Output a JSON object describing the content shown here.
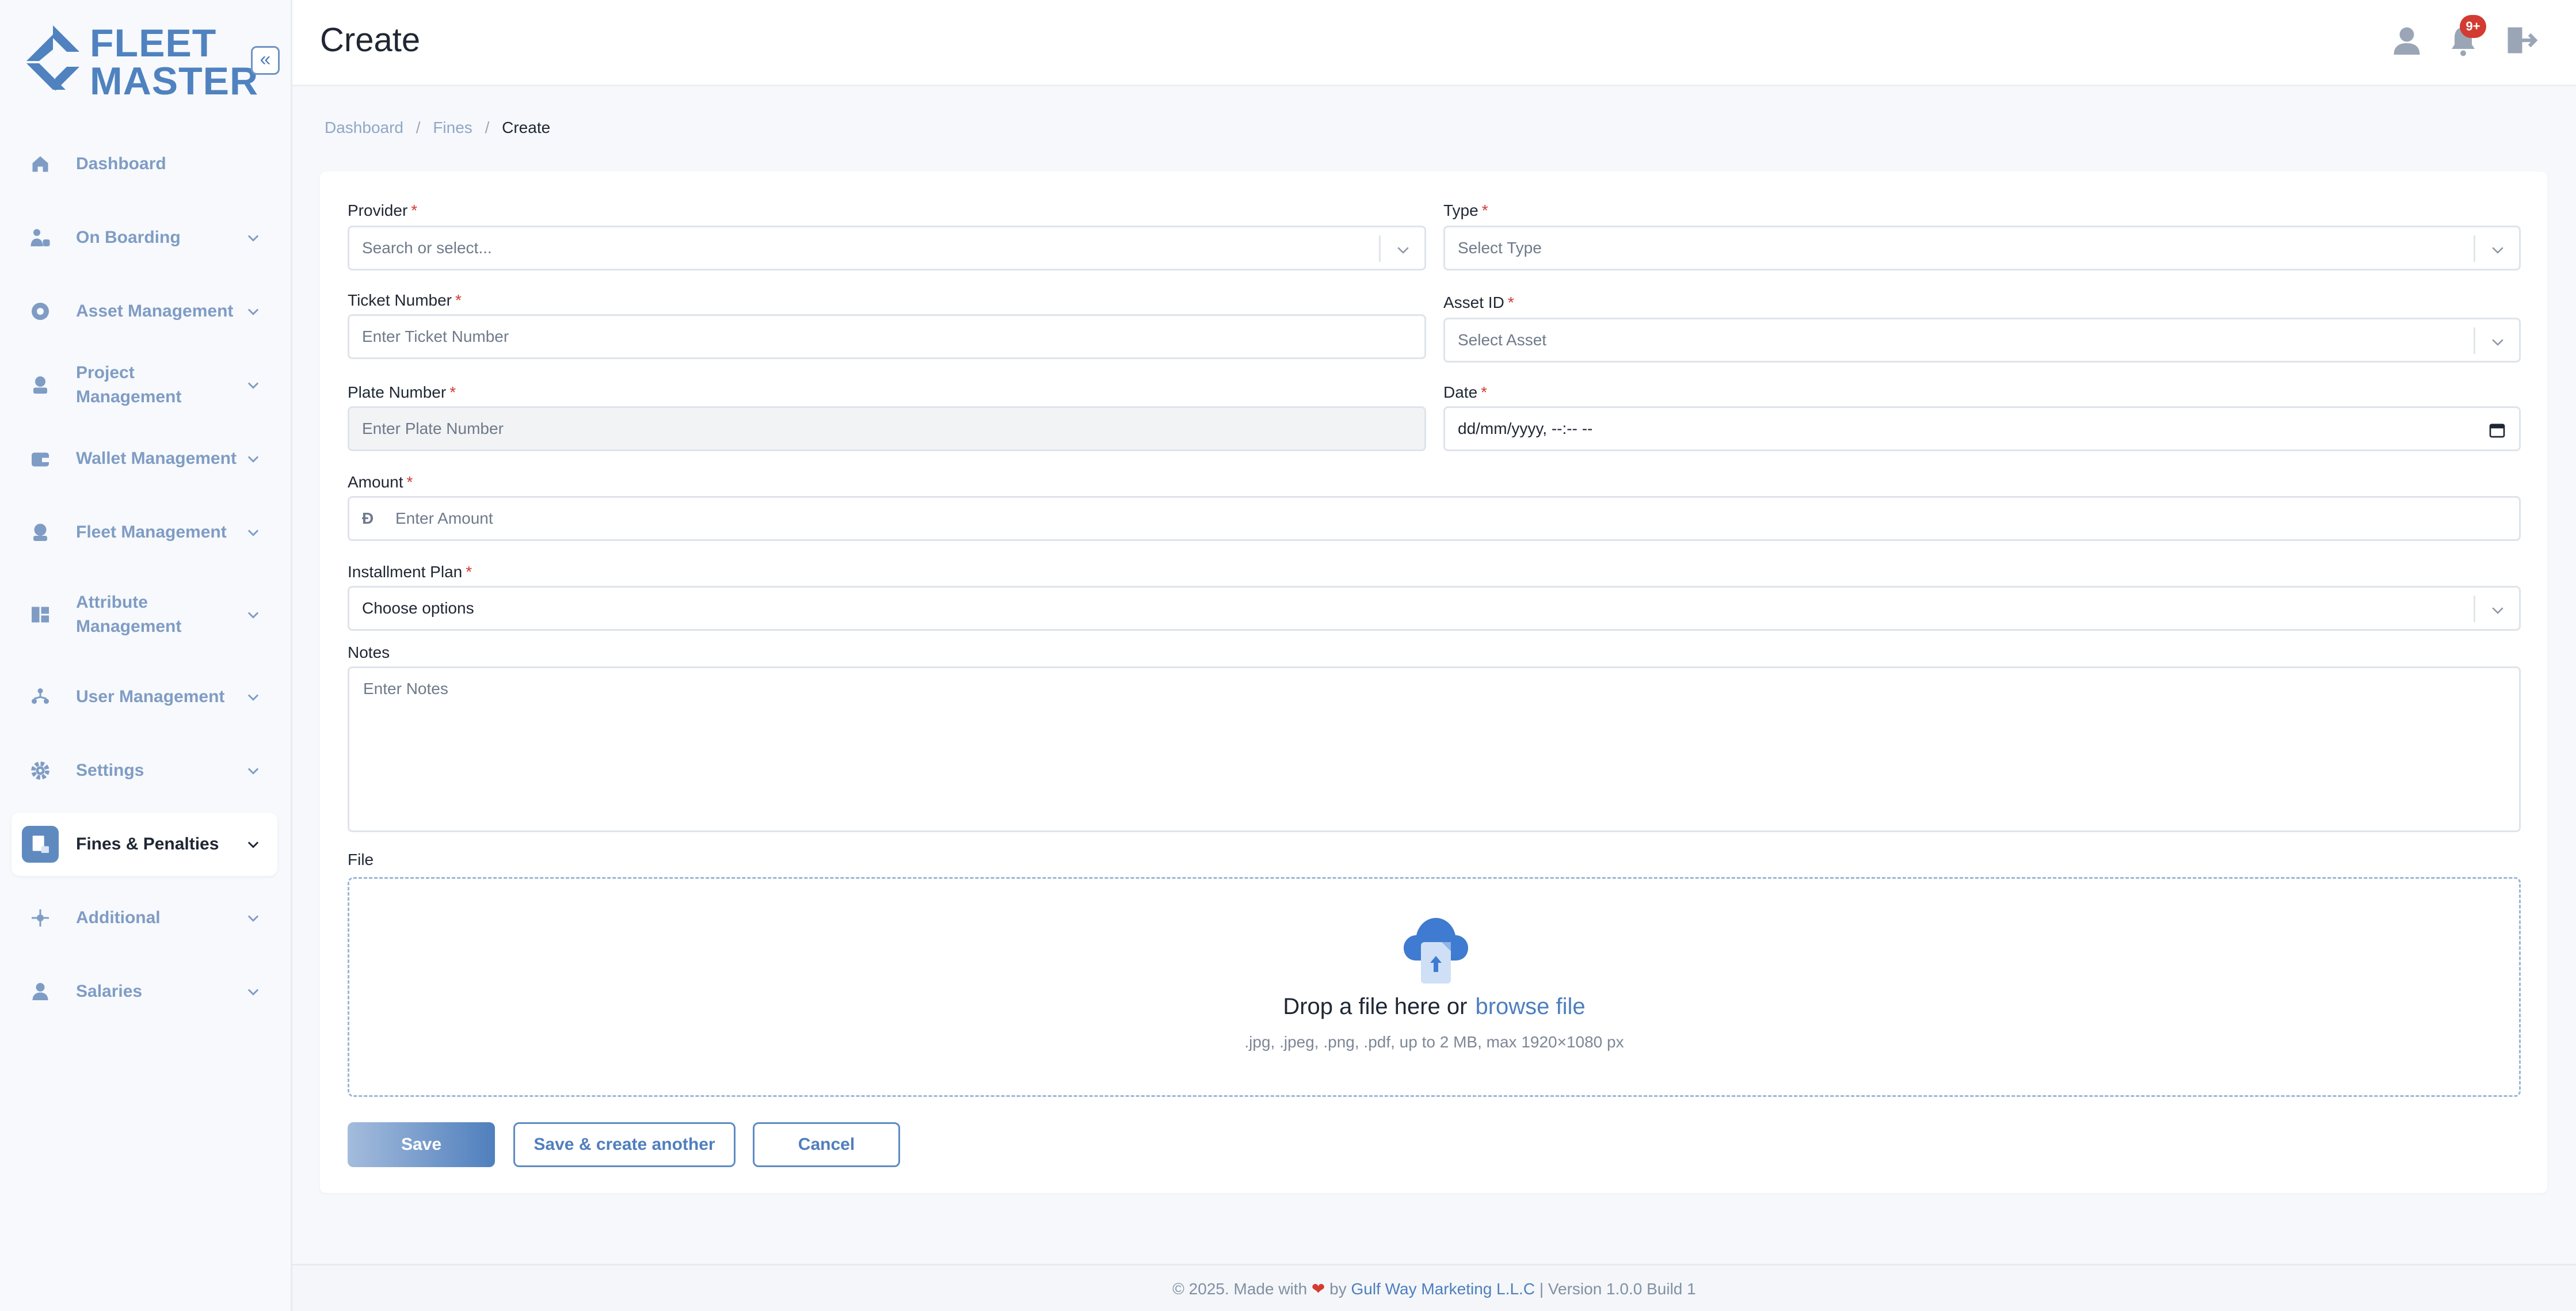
{
  "app": {
    "logo_line1": "FLEET",
    "logo_line2": "MASTER"
  },
  "sidebar": {
    "collapse_glyph": "«",
    "items": [
      {
        "label": "Dashboard",
        "icon": "home-icon"
      },
      {
        "label": "On Boarding",
        "icon": "onboarding-icon"
      },
      {
        "label": "Asset Management",
        "icon": "asset-icon"
      },
      {
        "label": "Project Management",
        "icon": "project-icon"
      },
      {
        "label": "Wallet Management",
        "icon": "wallet-icon"
      },
      {
        "label": "Fleet Management",
        "icon": "fleet-icon"
      },
      {
        "label": "Attribute Management",
        "icon": "attribute-icon"
      },
      {
        "label": "User Management",
        "icon": "users-icon"
      },
      {
        "label": "Settings",
        "icon": "gear-icon"
      },
      {
        "label": "Fines & Penalties",
        "icon": "fines-icon",
        "active": true
      },
      {
        "label": "Additional",
        "icon": "additional-icon"
      },
      {
        "label": "Salaries",
        "icon": "salaries-icon"
      }
    ]
  },
  "header": {
    "title": "Create",
    "notification_badge": "9+"
  },
  "breadcrumb": {
    "items": [
      "Dashboard",
      "Fines"
    ],
    "current": "Create",
    "separator": "/"
  },
  "form": {
    "required_mark": "*",
    "provider": {
      "label": "Provider",
      "placeholder": "Search or select..."
    },
    "type": {
      "label": "Type",
      "placeholder": "Select Type"
    },
    "ticket_number": {
      "label": "Ticket Number",
      "placeholder": "Enter Ticket Number"
    },
    "asset_id": {
      "label": "Asset ID",
      "placeholder": "Select Asset"
    },
    "plate_number": {
      "label": "Plate Number",
      "placeholder": "Enter Plate Number"
    },
    "date": {
      "label": "Date",
      "placeholder": "dd/mm/yyyy, --:-- --"
    },
    "amount": {
      "label": "Amount",
      "placeholder": "Enter Amount",
      "currency_glyph": "Đ"
    },
    "installment_plan": {
      "label": "Installment Plan",
      "placeholder": "Choose options"
    },
    "notes": {
      "label": "Notes",
      "placeholder": "Enter Notes"
    },
    "file": {
      "label": "File",
      "drop_text": "Drop a file here or",
      "browse_text": "browse file",
      "hint": ".jpg, .jpeg, .png, .pdf, up to 2 MB, max 1920×1080 px"
    },
    "buttons": {
      "save": "Save",
      "save_another": "Save & create another",
      "cancel": "Cancel"
    }
  },
  "footer": {
    "prefix": "© 2025. Made with",
    "by": "by",
    "company": "Gulf Way Marketing L.L.C",
    "version": "| Version 1.0.0 Build 1"
  },
  "colors": {
    "accent": "#4f82bf",
    "danger": "#d13a34",
    "sidebar_text": "#7f9cc4"
  }
}
